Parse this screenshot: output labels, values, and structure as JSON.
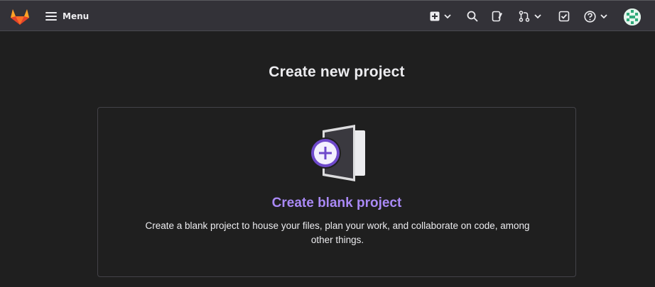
{
  "header": {
    "logo_icon": "gitlab-tanuki-logo",
    "menu_label": "Menu",
    "icons": [
      "plus-square-icon",
      "search-icon",
      "issues-icon",
      "merge-request-icon",
      "todo-checkbox-icon",
      "help-icon"
    ],
    "avatar": "user-avatar-identicon"
  },
  "main": {
    "title": "Create new project",
    "card": {
      "title": "Create blank project",
      "description": "Create a blank project to house your files, plan your work, and collaborate on code, among other things.",
      "illustration": "blank-project-plus-illustration"
    }
  },
  "colors": {
    "page_bg": "#1f1f1f",
    "topbar_bg": "#333238",
    "accent_purple": "#a989f5",
    "logo_orange": "#fc6d26"
  }
}
